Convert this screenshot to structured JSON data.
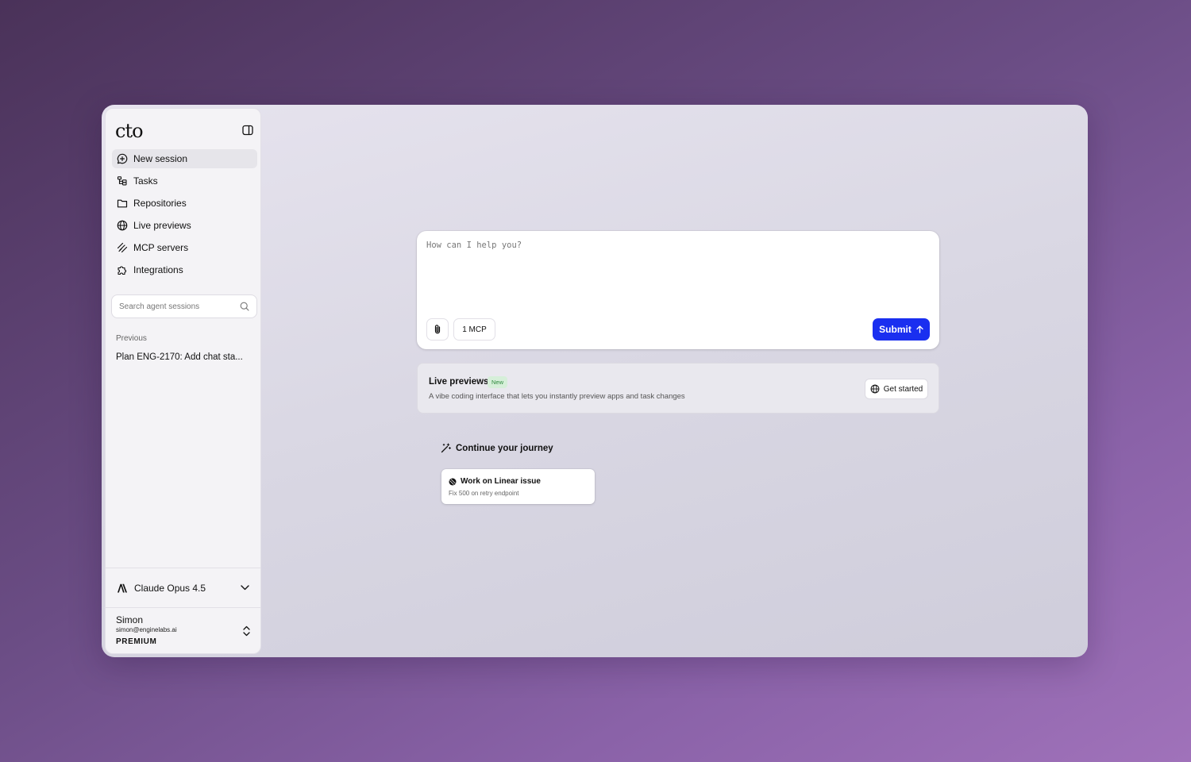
{
  "app": {
    "logo_text": "cto"
  },
  "sidebar": {
    "items": [
      {
        "label": "New session",
        "icon": "chat-plus-icon",
        "active": true
      },
      {
        "label": "Tasks",
        "icon": "tasks-icon"
      },
      {
        "label": "Repositories",
        "icon": "folder-icon"
      },
      {
        "label": "Live previews",
        "icon": "globe-icon"
      },
      {
        "label": "MCP servers",
        "icon": "mcp-icon"
      },
      {
        "label": "Integrations",
        "icon": "puzzle-icon"
      }
    ],
    "search_placeholder": "Search agent sessions",
    "previous_label": "Previous",
    "previous_sessions": [
      "Plan ENG-2170: Add chat sta..."
    ]
  },
  "model": {
    "name": "Claude Opus 4.5"
  },
  "user": {
    "name": "Simon",
    "email": "simon@enginelabs.ai",
    "plan": "PREMIUM"
  },
  "prompt": {
    "placeholder": "How can I help you?",
    "value": "",
    "mcp_label": "1 MCP",
    "submit_label": "Submit"
  },
  "live_previews": {
    "title": "Live previews",
    "badge": "New",
    "description": "A vibe coding interface that lets you instantly preview apps and task changes",
    "button_label": "Get started"
  },
  "journey": {
    "heading": "Continue your journey",
    "cards": [
      {
        "title": "Work on Linear issue",
        "subtitle": "Fix 500 on retry endpoint"
      }
    ]
  },
  "colors": {
    "accent": "#1a2ff0",
    "badge_green": "#2f8a3d"
  }
}
